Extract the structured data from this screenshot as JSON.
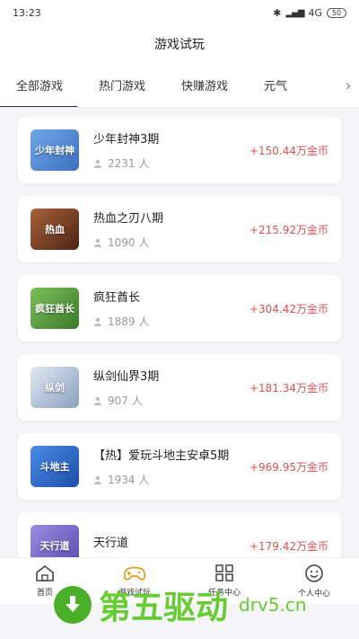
{
  "status_bar": {
    "time": "13:23",
    "network": "4G",
    "battery": "50"
  },
  "page_title": "游戏试玩",
  "tabs": [
    {
      "label": "全部游戏",
      "active": true
    },
    {
      "label": "热门游戏",
      "active": false
    },
    {
      "label": "快赚游戏",
      "active": false
    },
    {
      "label": "元气",
      "active": false
    }
  ],
  "games": [
    {
      "name": "少年封神3期",
      "players": "2231 人",
      "reward": "+150.44万金币",
      "thumb_color": "#5b8fd6",
      "thumb_text": "少年封神"
    },
    {
      "name": "热血之刃八期",
      "players": "1090 人",
      "reward": "+215.92万金币",
      "thumb_color": "#8a4a2b",
      "thumb_text": "热血"
    },
    {
      "name": "疯狂酋长",
      "players": "1889 人",
      "reward": "+304.42万金币",
      "thumb_color": "#3f8f3a",
      "thumb_text": "疯狂酋长"
    },
    {
      "name": "纵剑仙界3期",
      "players": "907 人",
      "reward": "+181.34万金币",
      "thumb_color": "#9fb3c9",
      "thumb_text": "纵剑"
    },
    {
      "name": "【热】爱玩斗地主安卓5期",
      "players": "1934 人",
      "reward": "+969.95万金币",
      "thumb_color": "#2f6fd1",
      "thumb_text": "斗地主"
    },
    {
      "name": "天行道",
      "players": "",
      "reward": "+179.42万金币",
      "thumb_color": "#7a6cc9",
      "thumb_text": "天行道"
    }
  ],
  "bottom_nav": [
    {
      "label": "首页",
      "icon": "home-icon"
    },
    {
      "label": "游戏试玩",
      "icon": "gamepad-icon"
    },
    {
      "label": "任务中心",
      "icon": "grid-icon"
    },
    {
      "label": "个人中心",
      "icon": "smile-icon"
    }
  ],
  "watermark": {
    "text": "第五驱动",
    "url": "drv5.cn"
  }
}
